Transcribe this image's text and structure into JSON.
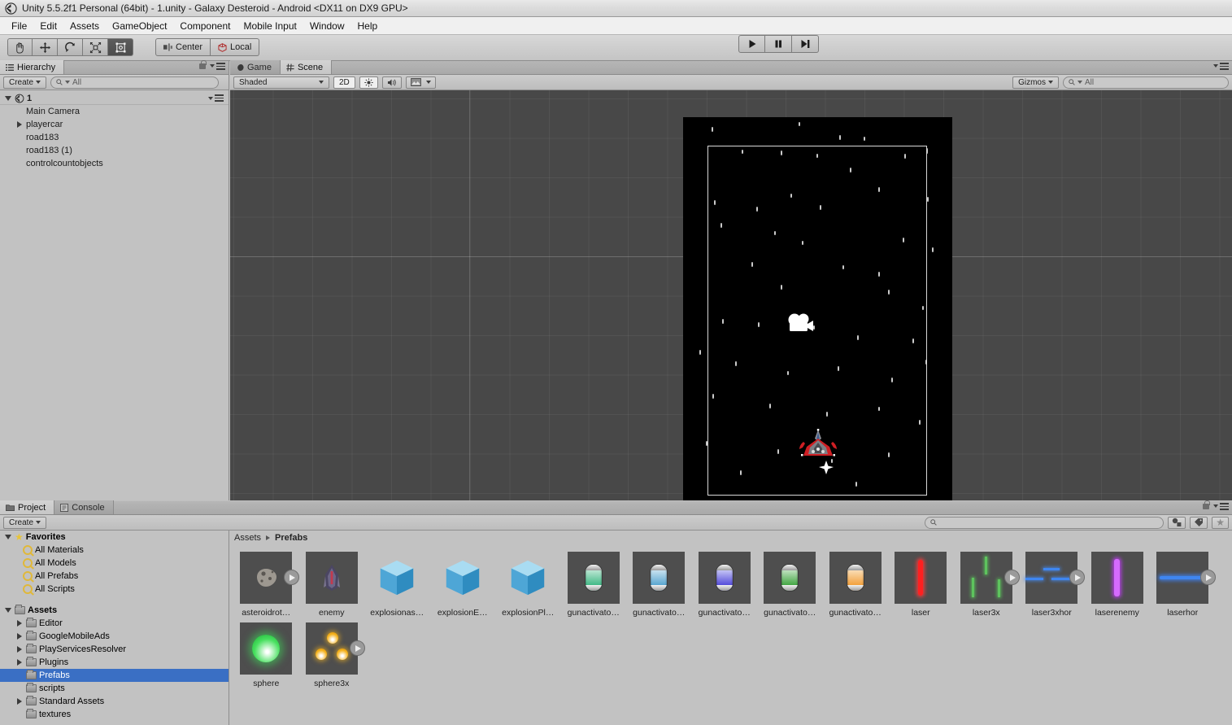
{
  "window": {
    "title": "Unity 5.5.2f1 Personal (64bit) - 1.unity - Galaxy Desteroid - Android <DX11 on DX9 GPU>",
    "logo_icon": "unity-logo-icon"
  },
  "menubar": {
    "items": [
      "File",
      "Edit",
      "Assets",
      "GameObject",
      "Component",
      "Mobile Input",
      "Window",
      "Help"
    ]
  },
  "toolbar": {
    "tools": [
      {
        "name": "hand-tool",
        "icon": "hand-icon",
        "active": false
      },
      {
        "name": "move-tool",
        "icon": "move-arrows-icon",
        "active": false
      },
      {
        "name": "rotate-tool",
        "icon": "rotate-icon",
        "active": false
      },
      {
        "name": "scale-tool",
        "icon": "scale-icon",
        "active": false
      },
      {
        "name": "rect-tool",
        "icon": "rect-transform-icon",
        "active": true
      }
    ],
    "pivot_label": "Center",
    "pivot_icon": "pivot-center-icon",
    "space_label": "Local",
    "space_icon": "local-space-icon",
    "play_icon": "play-icon",
    "pause_icon": "pause-icon",
    "step_icon": "step-icon"
  },
  "hierarchy": {
    "tab_label": "Hierarchy",
    "tab_icon": "hierarchy-icon",
    "create_label": "Create",
    "search_placeholder": "All",
    "search_value": "",
    "scene_name": "1",
    "scene_icon": "unity-scene-icon",
    "lock_icon": "lock-icon",
    "menu_icon": "hamburger-icon",
    "objects": [
      {
        "label": "Main Camera",
        "expandable": false
      },
      {
        "label": "playercar",
        "expandable": true
      },
      {
        "label": "road183",
        "expandable": false
      },
      {
        "label": "road183 (1)",
        "expandable": false
      },
      {
        "label": "controlcountobjects",
        "expandable": false
      }
    ]
  },
  "sceneview": {
    "tabs": [
      {
        "label": "Game",
        "icon": "game-view-icon",
        "active": false
      },
      {
        "label": "Scene",
        "icon": "scene-view-icon",
        "active": true
      }
    ],
    "draw_mode": "Shaded",
    "mode_2d_label": "2D",
    "mode_2d_active": true,
    "lighting_icon": "lighting-icon",
    "audio_icon": "audio-icon",
    "effects_icon": "effects-icon",
    "gizmos_label": "Gizmos",
    "search_placeholder": "All",
    "search_value": "",
    "menu_icon": "hamburger-icon",
    "camera_gizmo_icon": "camera-gizmo-icon",
    "player_ship_icon": "player-ship-sprite",
    "move_gizmo_icon": "move-gizmo-icon"
  },
  "project": {
    "tabs": [
      {
        "label": "Project",
        "icon": "project-folder-icon",
        "active": true
      },
      {
        "label": "Console",
        "icon": "console-icon",
        "active": false
      }
    ],
    "create_label": "Create",
    "search_placeholder": "",
    "search_value": "",
    "filter_type_icon": "filter-by-type-icon",
    "filter_label_icon": "filter-by-label-icon",
    "favorite_icon": "star-icon",
    "lock_icon": "lock-icon",
    "menu_icon": "hamburger-icon",
    "breadcrumb": [
      "Assets",
      "Prefabs"
    ],
    "tree": {
      "favorites_label": "Favorites",
      "favorites": [
        "All Materials",
        "All Models",
        "All Prefabs",
        "All Scripts"
      ],
      "assets_label": "Assets",
      "folders": [
        {
          "label": "Editor",
          "expandable": true,
          "selected": false
        },
        {
          "label": "GoogleMobileAds",
          "expandable": true,
          "selected": false
        },
        {
          "label": "PlayServicesResolver",
          "expandable": true,
          "selected": false
        },
        {
          "label": "Plugins",
          "expandable": true,
          "selected": false
        },
        {
          "label": "Prefabs",
          "expandable": false,
          "selected": true
        },
        {
          "label": "scripts",
          "expandable": false,
          "selected": false
        },
        {
          "label": "Standard Assets",
          "expandable": true,
          "selected": false
        },
        {
          "label": "textures",
          "expandable": false,
          "selected": false
        }
      ]
    },
    "assets": [
      {
        "label": "asteroidrot…",
        "icon": "asteroid-prefab-icon",
        "kind": "sprite",
        "badge": true,
        "color": "#9d9890"
      },
      {
        "label": "enemy",
        "icon": "enemy-ship-prefab-icon",
        "kind": "sprite",
        "badge": false,
        "color": "#5b5570"
      },
      {
        "label": "explosionas…",
        "icon": "prefab-cube-icon",
        "kind": "cube",
        "badge": false,
        "color": "#5ab4e0"
      },
      {
        "label": "explosionE…",
        "icon": "prefab-cube-icon",
        "kind": "cube",
        "badge": false,
        "color": "#5ab4e0"
      },
      {
        "label": "explosionPl…",
        "icon": "prefab-cube-icon",
        "kind": "cube",
        "badge": false,
        "color": "#5ab4e0"
      },
      {
        "label": "gunactivato…",
        "icon": "capsule-prefab-icon",
        "kind": "capsule",
        "badge": false,
        "color": "#2bbd7e"
      },
      {
        "label": "gunactivato…",
        "icon": "capsule-prefab-icon",
        "kind": "capsule",
        "badge": false,
        "color": "#3aa8d8"
      },
      {
        "label": "gunactivato…",
        "icon": "capsule-prefab-icon",
        "kind": "capsule",
        "badge": false,
        "color": "#3a2fd2"
      },
      {
        "label": "gunactivato…",
        "icon": "capsule-prefab-icon",
        "kind": "capsule",
        "badge": false,
        "color": "#2aa02a"
      },
      {
        "label": "gunactivato…",
        "icon": "capsule-prefab-icon",
        "kind": "capsule",
        "badge": false,
        "color": "#f0921c"
      },
      {
        "label": "laser",
        "icon": "laser-beam-icon",
        "kind": "line-v",
        "badge": false,
        "color": "#ff2d2d"
      },
      {
        "label": "laser3x",
        "icon": "laser-triple-icon",
        "kind": "triple-v",
        "badge": true,
        "color": "#55c25a"
      },
      {
        "label": "laser3xhor",
        "icon": "laser-triple-horizontal-icon",
        "kind": "triple-h",
        "badge": true,
        "color": "#3f86f0"
      },
      {
        "label": "laserenemy",
        "icon": "laser-enemy-icon",
        "kind": "line-v",
        "badge": false,
        "color": "#c040f5"
      },
      {
        "label": "laserhor",
        "icon": "laser-horizontal-icon",
        "kind": "line-h",
        "badge": true,
        "color": "#2f7df0"
      },
      {
        "label": "sphere",
        "icon": "sphere-prefab-icon",
        "kind": "sphere",
        "badge": false,
        "color": "#2fd94f"
      },
      {
        "label": "sphere3x",
        "icon": "sphere-triple-prefab-icon",
        "kind": "sphere3",
        "badge": true,
        "color": "#f0a81e"
      }
    ]
  },
  "colors": {
    "selection_blue": "#3a6fc4",
    "panel_gray": "#c2c2c2",
    "scene_bg": "#484848",
    "game_bg": "#000000"
  }
}
